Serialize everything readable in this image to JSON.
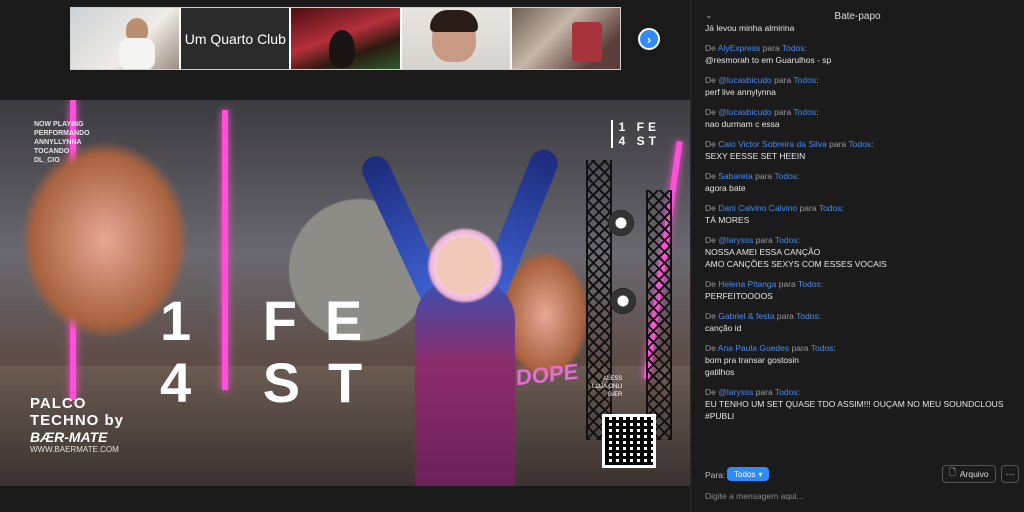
{
  "thumbnails": {
    "tile_label": "Um Quarto Club"
  },
  "stage": {
    "now_playing": [
      "NOW PLAYING",
      "PERFORMANDO",
      "ANNYLLYNNA",
      "TOCANDO",
      "DL_CIO"
    ],
    "fest_small": [
      "1 FE",
      "4 ST"
    ],
    "fest_big_top": "1 FE",
    "fest_big_bottom": "4 ST",
    "sponsor_line1": "PALCO",
    "sponsor_line2": "TECHNO by",
    "sponsor_brand": "BÆR-MATE",
    "sponsor_url": "WWW.BAERMATE.COM",
    "dope": "DOPE",
    "stand_text": [
      "ALESS",
      "LOJA ONLI",
      "BÆR"
    ]
  },
  "chat": {
    "title": "Bate-papo",
    "top_partial": "Já levou minha almirina",
    "from_word": "De",
    "to_word": "para",
    "recipient": "Todos",
    "messages": [
      {
        "sender": "AlyExpress",
        "lines": [
          "@resmorah to em Guarulhos - sp"
        ]
      },
      {
        "sender": "@lucasbicudo",
        "lines": [
          "perf live annylynna"
        ]
      },
      {
        "sender": "@lucasbicudo",
        "lines": [
          "nao durmam c essa"
        ]
      },
      {
        "sender": "Caio Victor Sobreira da Silva",
        "lines": [
          "SEXY EESSE SET HEEIN"
        ]
      },
      {
        "sender": "Sabareta",
        "lines": [
          "agora bate"
        ]
      },
      {
        "sender": "Dani Calvino Calvino",
        "lines": [
          "TÁ MORES"
        ]
      },
      {
        "sender": "@larysss",
        "lines": [
          "NOSSA AMEI ESSA CANÇÃO",
          "AMO CANÇÕES SEXYS COM ESSES VOCAIS"
        ]
      },
      {
        "sender": "Helena Pitanga",
        "lines": [
          "PERFEITOOOOS"
        ]
      },
      {
        "sender": "Gabriel & festa",
        "lines": [
          "canção id"
        ]
      },
      {
        "sender": "Ana Paula Guedes",
        "lines": [
          "bom pra transar gostosin",
          "gatilhos"
        ]
      },
      {
        "sender": "@larysss",
        "lines": [
          "EU TENHO UM SET QUASE TDO ASSIM!!! OUÇAM NO MEU SOUNDCLOUS",
          "#PUBLI"
        ]
      }
    ],
    "footer": {
      "to_label": "Para:",
      "to_value": "Todos",
      "file_label": "Arquivo",
      "more_label": "···",
      "placeholder": "Digite a mensagem aqui..."
    }
  },
  "colors": {
    "accent": "#2d8cff",
    "sender_name": "#4a8cf0",
    "panel_bg": "#1b1b1b"
  }
}
